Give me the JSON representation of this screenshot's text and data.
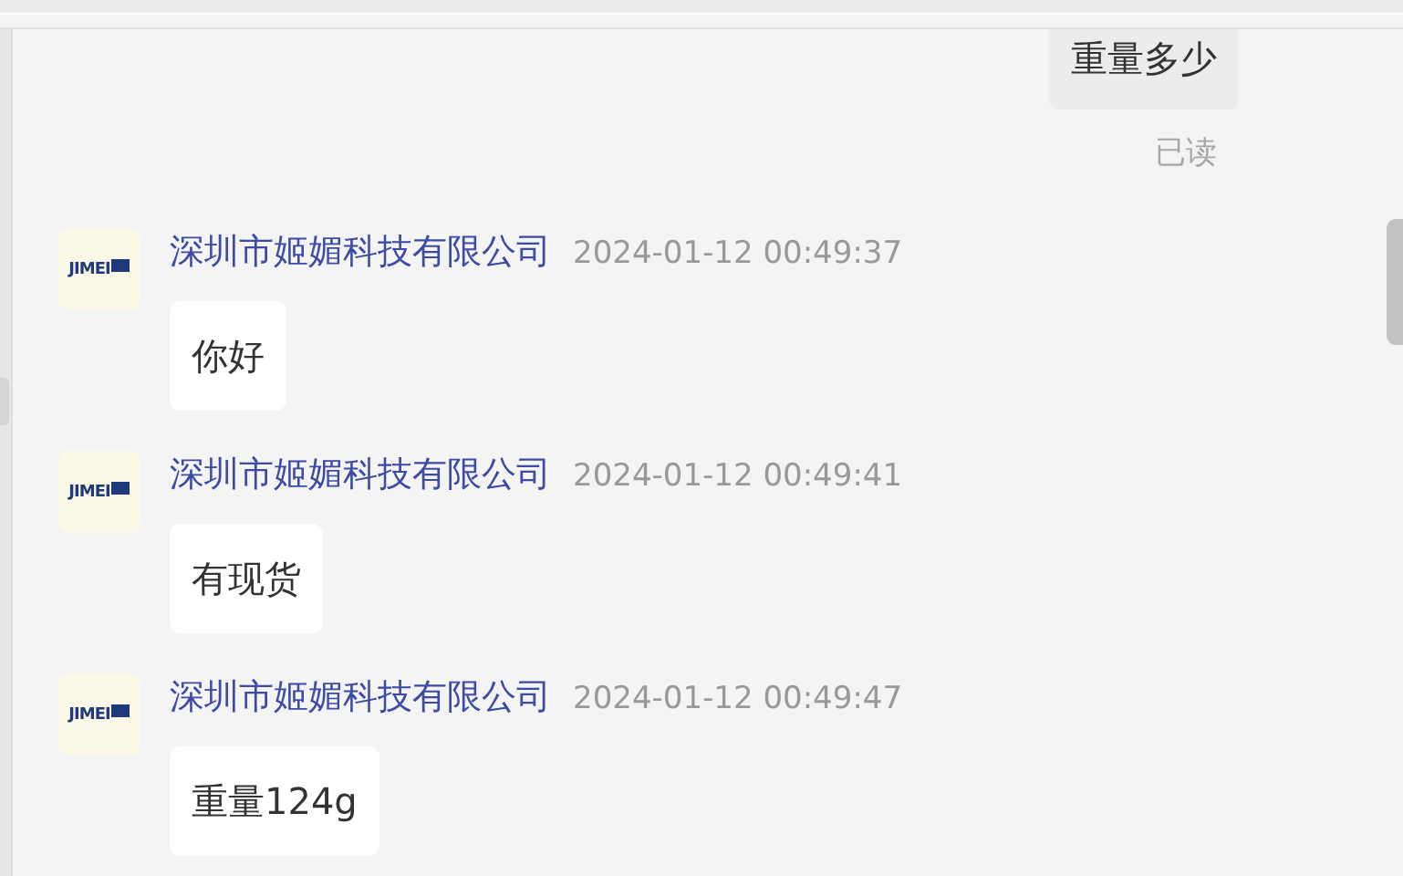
{
  "sent_message": {
    "text": "重量多少",
    "read_status": "已读"
  },
  "messages": [
    {
      "logo_text": "JIMEI",
      "sender": "深圳市姬媚科技有限公司",
      "time": "2024-01-12 00:49:37",
      "text": "你好"
    },
    {
      "logo_text": "JIMEI",
      "sender": "深圳市姬媚科技有限公司",
      "time": "2024-01-12 00:49:41",
      "text": "有现货"
    },
    {
      "logo_text": "JIMEI",
      "sender": "深圳市姬媚科技有限公司",
      "time": "2024-01-12 00:49:47",
      "text": "重量124g"
    }
  ]
}
